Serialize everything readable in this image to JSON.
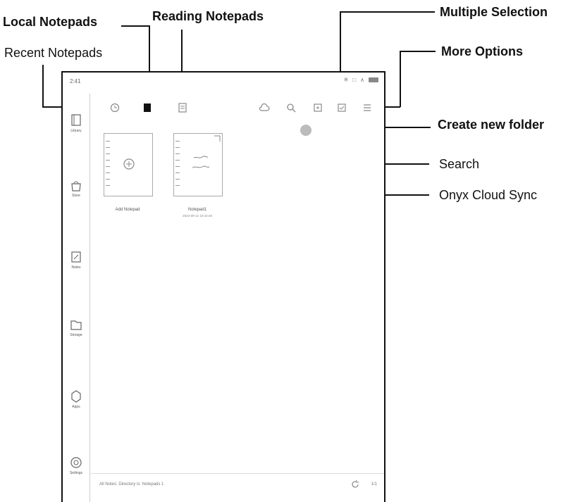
{
  "callouts": {
    "local_notepads": "Local Notepads",
    "reading_notepads": "Reading Notepads",
    "recent_notepads": "Recent Notepads",
    "multiple_selection": "Multiple Selection",
    "more_options": "More Options",
    "create_new_folder": "Create new folder",
    "search": "Search",
    "onyx_cloud_sync": "Onyx Cloud Sync"
  },
  "status": {
    "time": "2:41"
  },
  "sidebar": {
    "items": [
      {
        "label": "Library",
        "icon": "library-icon"
      },
      {
        "label": "Store",
        "icon": "store-icon"
      },
      {
        "label": "Notes",
        "icon": "notes-icon"
      },
      {
        "label": "Storage",
        "icon": "storage-icon"
      },
      {
        "label": "Apps",
        "icon": "apps-icon"
      },
      {
        "label": "Settings",
        "icon": "settings-icon"
      }
    ]
  },
  "notepads": [
    {
      "title": "Add Notepad",
      "date": ""
    },
    {
      "title": "Notepad1",
      "date": "2022-09-12 10:42:48"
    }
  ],
  "footer": {
    "path": "All Notes: Directory is: Notepads 1",
    "page": "1/1"
  }
}
